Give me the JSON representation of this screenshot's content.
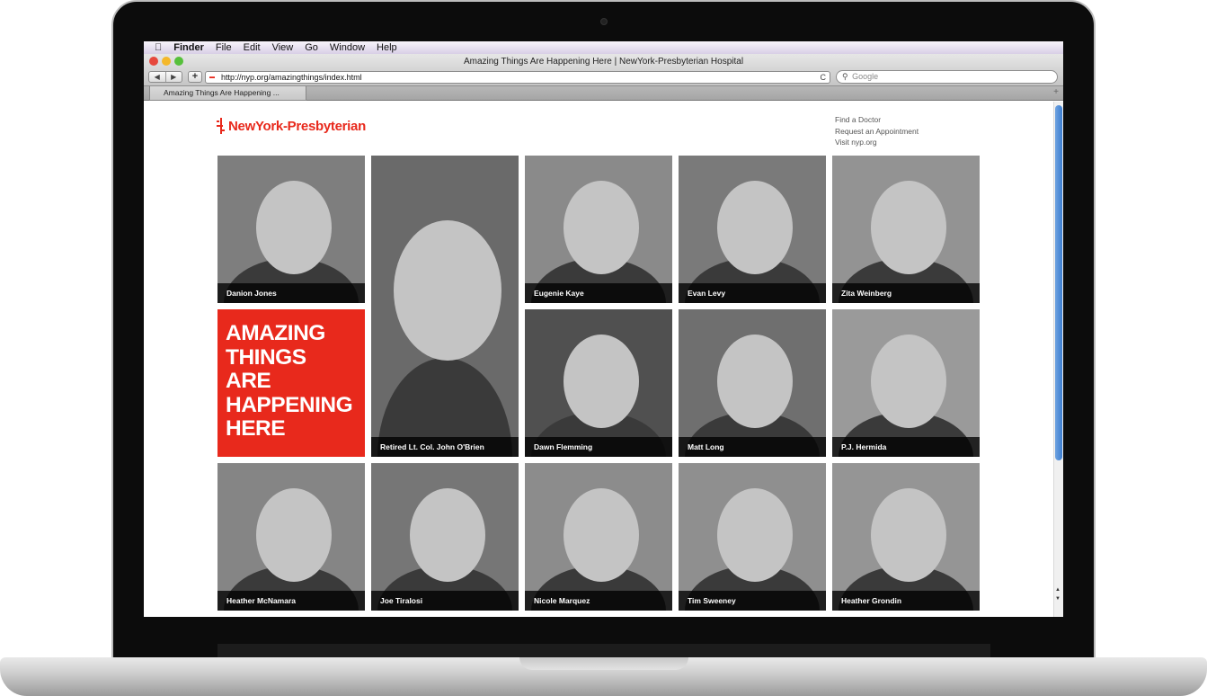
{
  "menubar": {
    "app": "Finder",
    "items": [
      "File",
      "Edit",
      "View",
      "Go",
      "Window",
      "Help"
    ]
  },
  "window": {
    "title": "Amazing Things Are Happening Here | NewYork-Presbyterian Hospital"
  },
  "toolbar": {
    "back_glyph": "◀",
    "forward_glyph": "▶",
    "add_glyph": "+",
    "url": "http://nyp.org/amazingthings/index.html",
    "reload_glyph": "C",
    "search_placeholder": "Google"
  },
  "tabs": [
    {
      "label": "Amazing Things Are Happening ..."
    }
  ],
  "page": {
    "logo_text": "NewYork-Presbyterian",
    "links": [
      "Find a Doctor",
      "Request an Appointment",
      "Visit nyp.org"
    ],
    "tagline_lines": [
      "AMAZING",
      "THINGS",
      "ARE",
      "HAPPENING",
      "HERE"
    ],
    "people": [
      {
        "name": "Danion Jones",
        "tone": "#7e7e7e"
      },
      {
        "name": "Retired Lt. Col. John O'Brien",
        "tone": "#6a6a6a"
      },
      {
        "name": "Eugenie Kaye",
        "tone": "#8a8a8a"
      },
      {
        "name": "Evan Levy",
        "tone": "#7a7a7a"
      },
      {
        "name": "Zita Weinberg",
        "tone": "#939393"
      },
      {
        "name": "Dawn Flemming",
        "tone": "#505050"
      },
      {
        "name": "Matt Long",
        "tone": "#6f6f6f"
      },
      {
        "name": "P.J. Hermida",
        "tone": "#9a9a9a"
      },
      {
        "name": "Heather McNamara",
        "tone": "#858585"
      },
      {
        "name": "Joe Tiralosi",
        "tone": "#767676"
      },
      {
        "name": "Nicole Marquez",
        "tone": "#8c8c8c"
      },
      {
        "name": "Tim Sweeney",
        "tone": "#8f8f8f"
      },
      {
        "name": "Heather Grondin",
        "tone": "#959595"
      }
    ]
  },
  "colors": {
    "brand_red": "#e8291c",
    "caption_bg": "#000000",
    "scroll_thumb": "#4a89d8"
  },
  "icons": {
    "apple": "apple-icon",
    "search": "search-icon",
    "reload": "reload-icon"
  }
}
